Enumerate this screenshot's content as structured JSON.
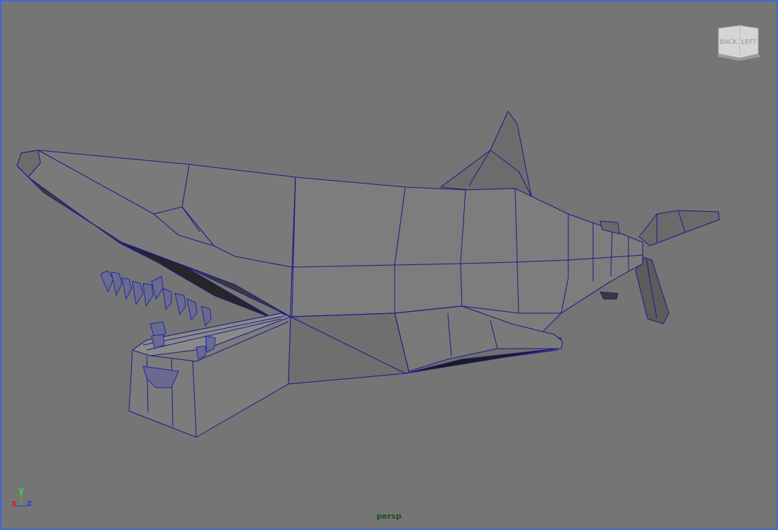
{
  "viewport": {
    "camera_name": "persp",
    "background": "#757575",
    "border_color": "#3c6ad6",
    "wire_color": "#1a1a8a"
  },
  "viewcube": {
    "faces": {
      "back": "BACK",
      "left": "LEFT"
    }
  },
  "axis_indicator": {
    "x": "x",
    "y": "y",
    "z": "z",
    "x_color": "#d42020",
    "y_color": "#3fcf3f",
    "z_color": "#2e3fd8"
  },
  "scene": {
    "object": "shark-mesh",
    "display_mode": "shaded-wireframe"
  }
}
